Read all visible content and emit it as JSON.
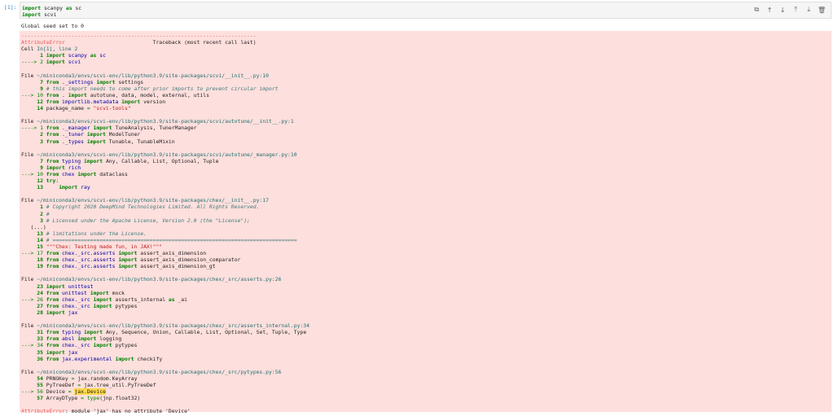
{
  "cell": {
    "prompt": "[1]:",
    "code_line1_kw": "import",
    "code_line1_rest": " scanpy ",
    "code_line1_as": "as",
    "code_line1_alias": " sc",
    "code_line2_kw": "import",
    "code_line2_rest": " scvi"
  },
  "toolbar": {
    "icons": [
      "duplicate-icon",
      "move-up-icon",
      "move-down-icon",
      "insert-above-icon",
      "insert-below-icon",
      "delete-icon"
    ]
  },
  "output": {
    "stdout": "Global seed set to 0"
  }
}
